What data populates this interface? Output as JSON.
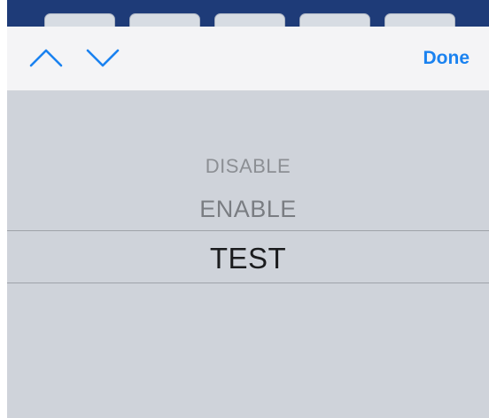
{
  "toolbar": {
    "previous_icon": "chevron-up-icon",
    "next_icon": "chevron-down-icon",
    "done_label": "Done",
    "accent_color": "#1a82f0"
  },
  "picker": {
    "options": [
      "DISABLE",
      "ENABLE",
      "TEST"
    ],
    "selected": "TEST"
  },
  "colors": {
    "header_strip": "#1e3b78",
    "toolbar_bg": "#f4f4f6",
    "picker_bg": "#cfd3da"
  }
}
